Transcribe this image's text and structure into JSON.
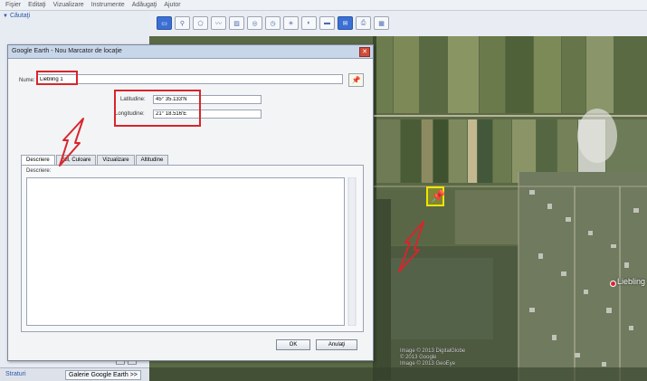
{
  "menu": [
    "Fişier",
    "Editaţi",
    "Vizualizare",
    "Instrumente",
    "Adăugaţi",
    "Ajutor"
  ],
  "left_panel": {
    "search_label": "Căutaţi",
    "places_tab": "Straturi",
    "gallery_tab": "Galerie Google Earth >>"
  },
  "dialog": {
    "title": "Google Earth - Nou Marcator de locaţie",
    "name_label": "Nume:",
    "name_value": "Liebling 1",
    "latitude_label": "Latitudine:",
    "latitude_value": "45° 35.133'N",
    "longitude_label": "Longitudine:",
    "longitude_value": "21° 18.516'E",
    "tabs": [
      "Descriere",
      "Stil, Culoare",
      "Vizualizare",
      "Altitudine"
    ],
    "active_tab": "Descriere",
    "description_label": "Descriere:",
    "ok_label": "OK",
    "cancel_label": "Anulaţi"
  },
  "map": {
    "place_label": "Liebling",
    "copyright_line1": "Image © 2013 DigitalGlobe",
    "copyright_line2": "© 2013 Google",
    "copyright_line3": "Image © 2013 GeoEye"
  },
  "colors": {
    "highlight": "#d8252b",
    "pin": "#f2e400"
  }
}
